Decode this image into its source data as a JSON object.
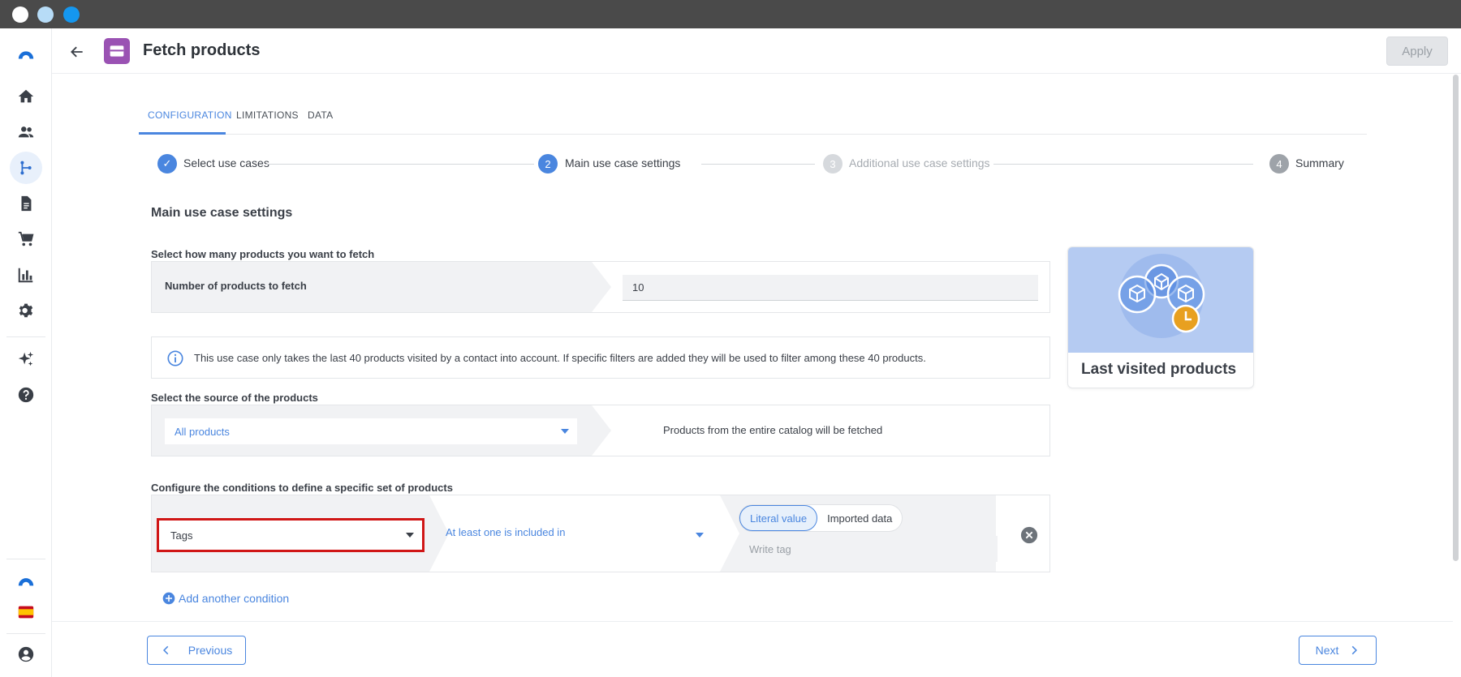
{
  "header": {
    "title": "Fetch products",
    "apply_label": "Apply"
  },
  "sidebar": {
    "items": [
      {
        "icon": "logo-icon"
      },
      {
        "icon": "home-icon"
      },
      {
        "icon": "people-icon"
      },
      {
        "icon": "workflow-icon",
        "active": true
      },
      {
        "icon": "document-icon"
      },
      {
        "icon": "cart-icon"
      },
      {
        "icon": "chart-icon"
      },
      {
        "icon": "gear-icon"
      },
      {
        "icon": "sparkle-icon"
      },
      {
        "icon": "help-icon"
      }
    ],
    "bottom": [
      {
        "icon": "brand-icon"
      },
      {
        "icon": "spain-flag-icon"
      },
      {
        "icon": "account-icon"
      }
    ]
  },
  "tabs": [
    {
      "label": "CONFIGURATION",
      "active": true
    },
    {
      "label": "LIMITATIONS",
      "active": false
    },
    {
      "label": "DATA",
      "active": false
    }
  ],
  "stepper": [
    {
      "marker": "✓",
      "label": "Select use cases",
      "state": "done"
    },
    {
      "marker": "2",
      "label": "Main use case settings",
      "state": "current"
    },
    {
      "marker": "3",
      "label": "Additional use case settings",
      "state": "pending"
    },
    {
      "marker": "4",
      "label": "Summary",
      "state": "pending-dark"
    }
  ],
  "main": {
    "section_title": "Main use case settings",
    "fetch_count": {
      "question": "Select how many products you want to fetch",
      "label": "Number of products to fetch",
      "value": "10"
    },
    "info_text": "This use case only takes the last 40 products visited by a contact into account. If specific filters are added they will be used to filter among these 40 products.",
    "source": {
      "question": "Select the source of the products",
      "selected": "All products",
      "description": "Products from the entire catalog will be fetched"
    },
    "conditions": {
      "question": "Configure the conditions to define a specific set of products",
      "field": "Tags",
      "operator": "At least one is included in",
      "toggle": {
        "on": "Literal value",
        "off": "Imported data"
      },
      "input_placeholder": "Write tag",
      "add_label": "Add another condition"
    }
  },
  "card": {
    "title": "Last visited products"
  },
  "footer": {
    "previous_label": "Previous",
    "next_label": "Next"
  },
  "colors": {
    "accent": "#4a86df",
    "app_badge": "#9a52b3",
    "highlight": "#d01616",
    "card_bg": "#b5cbf2",
    "clock": "#e8a020"
  }
}
